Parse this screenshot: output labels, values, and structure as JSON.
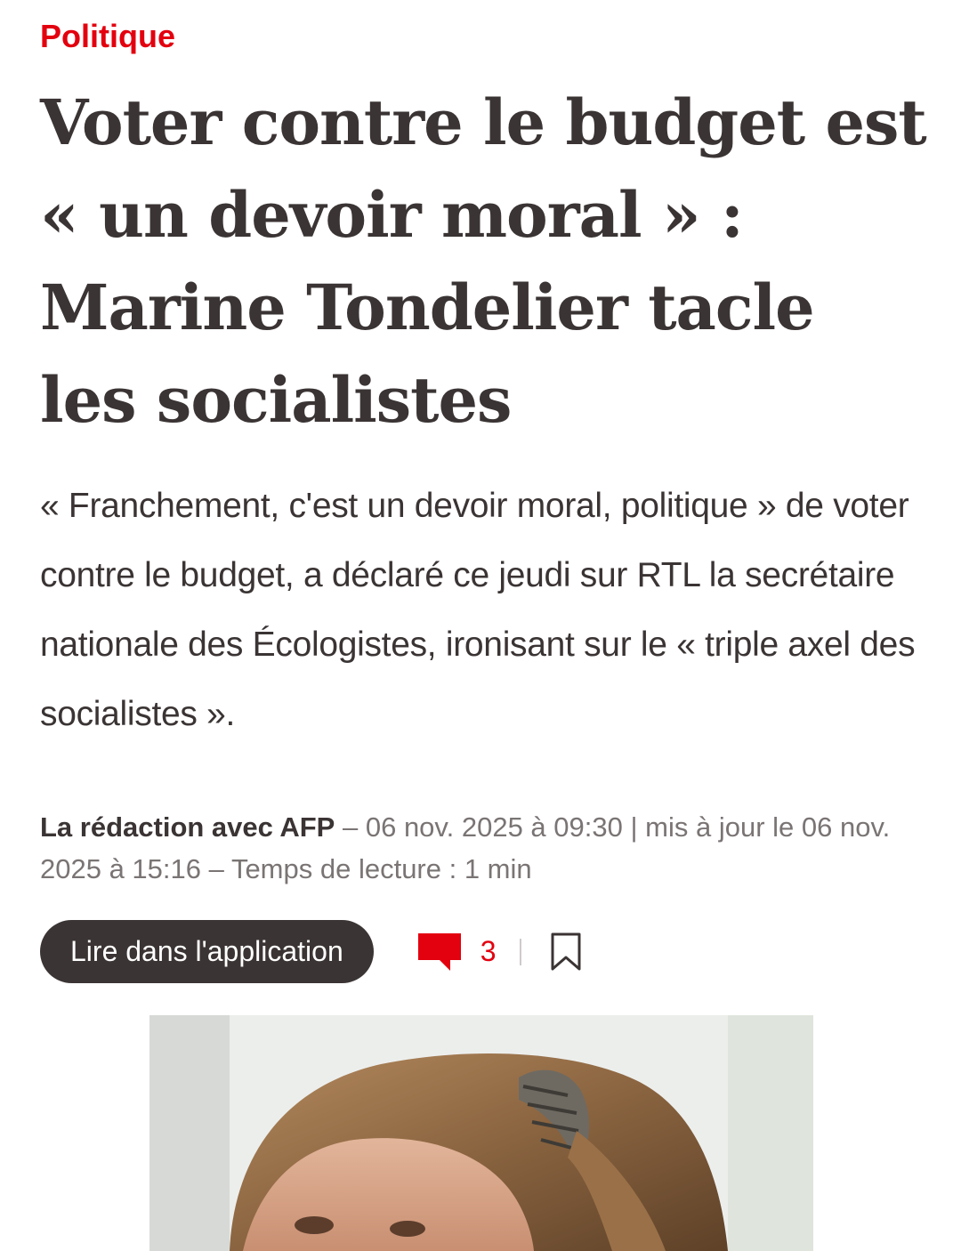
{
  "article": {
    "category": "Politique",
    "title": "Voter contre le budget est « un devoir moral » : Marine Tondelier tacle les socialistes",
    "chapo": "« Franchement, c'est un devoir moral, politique » de voter contre le budget, a déclaré ce jeudi sur RTL la secrétaire nationale des Écologistes, ironisant sur le « triple axel des socialistes ».",
    "author": "La rédaction avec AFP",
    "published": "06 nov. 2025 à 09:30",
    "updated_label": "mis à jour le 06 nov. 2025 à 15:16",
    "reading_time": "Temps de lecture : 1 min"
  },
  "actions": {
    "app_button_label": "Lire dans l'application",
    "comment_count": "3",
    "comment_icon": "comment-icon",
    "bookmark_icon": "bookmark-icon"
  },
  "colors": {
    "accent": "#e3000f",
    "text": "#3b3434",
    "meta": "#7a7474"
  }
}
